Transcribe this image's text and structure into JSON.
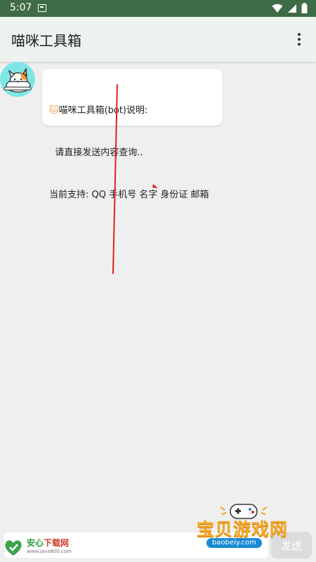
{
  "status_bar": {
    "time": "5:07"
  },
  "app_bar": {
    "title": "喵咪工具箱"
  },
  "chat": {
    "bot_message": {
      "lines": [
        "喵咪工具箱(bot)说明:",
        "  请直接发送内容查询..",
        "当前支持: QQ 手机号 名字 身份证 邮箱"
      ]
    }
  },
  "input": {
    "placeholder": "",
    "send_label": "发送"
  },
  "watermarks": {
    "anxin": {
      "name_green": "安心",
      "name_red": "下载网",
      "url": "www.java800.com"
    },
    "baobei": {
      "name": "宝贝游戏网",
      "url": "baobeiy.com"
    }
  },
  "colors": {
    "status_bar": "#3f6b46",
    "app_bar": "#ecf3ee",
    "avatar_bg": "#7fe6e6",
    "annotation": "#e0201c"
  }
}
